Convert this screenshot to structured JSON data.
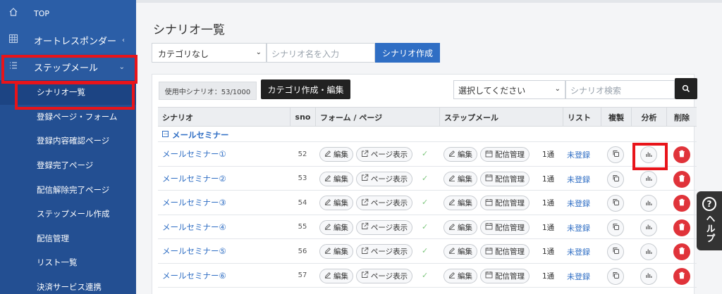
{
  "sidebar": {
    "top_label": "TOP",
    "autoresponder_label": "オートレスポンダー",
    "stepmail_label": "ステップメール",
    "sub_items": [
      "シナリオ一覧",
      "登録ページ・フォーム",
      "登録内容確認ページ",
      "登録完了ページ",
      "配信解除完了ページ",
      "ステップメール作成",
      "配信管理",
      "リスト一覧",
      "決済サービス連携"
    ]
  },
  "main": {
    "title": "シナリオ一覧",
    "category_select": "カテゴリなし",
    "name_placeholder": "シナリオ名を入力",
    "create_button": "シナリオ作成",
    "used_badge": "使用中シナリオ：53/1000",
    "category_edit_button": "カテゴリ作成・編集",
    "filter_select": "選択してください",
    "search_placeholder": "シナリオ検索"
  },
  "table": {
    "headers": {
      "scenario": "シナリオ",
      "sno": "sno",
      "form_page": "フォーム / ページ",
      "stepmail": "ステップメール",
      "list": "リスト",
      "copy": "複製",
      "analysis": "分析",
      "delete": "削除"
    },
    "group_toggle": "－",
    "group_name": "メールセミナー",
    "edit_label": "編集",
    "page_view_label": "ページ表示",
    "delivery_label": "配信管理",
    "check_mark": "✓",
    "rows": [
      {
        "name": "メールセミナー①",
        "sno": "52",
        "count": "1通",
        "list": "未登録"
      },
      {
        "name": "メールセミナー②",
        "sno": "53",
        "count": "1通",
        "list": "未登録"
      },
      {
        "name": "メールセミナー③",
        "sno": "54",
        "count": "1通",
        "list": "未登録"
      },
      {
        "name": "メールセミナー④",
        "sno": "55",
        "count": "1通",
        "list": "未登録"
      },
      {
        "name": "メールセミナー⑤",
        "sno": "56",
        "count": "1通",
        "list": "未登録"
      },
      {
        "name": "メールセミナー⑥",
        "sno": "57",
        "count": "1通",
        "list": "未登録"
      }
    ]
  },
  "help": {
    "label": "ヘルプ"
  },
  "colors": {
    "sidebar": "#2b5ea7",
    "accent": "#2f6ec4",
    "delete": "#e0333a",
    "highlight": "#e8141a"
  }
}
